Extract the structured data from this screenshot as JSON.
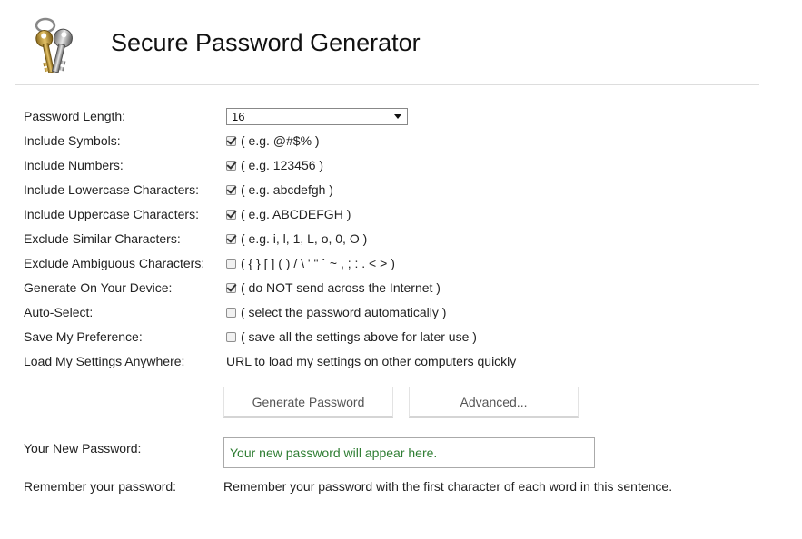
{
  "header": {
    "title": "Secure Password Generator"
  },
  "form": {
    "length": {
      "label": "Password Length:",
      "selected": "16"
    },
    "symbols": {
      "label": "Include Symbols:",
      "checked": true,
      "hint": "( e.g. @#$% )"
    },
    "numbers": {
      "label": "Include Numbers:",
      "checked": true,
      "hint": "( e.g. 123456 )"
    },
    "lowercase": {
      "label": "Include Lowercase Characters:",
      "checked": true,
      "hint": "( e.g. abcdefgh )"
    },
    "uppercase": {
      "label": "Include Uppercase Characters:",
      "checked": true,
      "hint": "( e.g. ABCDEFGH )"
    },
    "similar": {
      "label": "Exclude Similar Characters:",
      "checked": true,
      "hint": "( e.g. i, l, 1, L, o, 0, O )"
    },
    "ambiguous": {
      "label": "Exclude Ambiguous Characters:",
      "checked": false,
      "hint": "( { } [ ] ( ) / \\ ' \" ` ~ , ; : . < > )"
    },
    "device": {
      "label": "Generate On Your Device:",
      "checked": true,
      "hint": "( do NOT send across the Internet )"
    },
    "autoselect": {
      "label": "Auto-Select:",
      "checked": false,
      "hint": "( select the password automatically )"
    },
    "preference": {
      "label": "Save My Preference:",
      "checked": false,
      "hint": "( save all the settings above for later use )"
    },
    "load": {
      "label": "Load My Settings Anywhere:",
      "value": "URL to load my settings on other computers quickly"
    }
  },
  "buttons": {
    "generate": "Generate Password",
    "advanced": "Advanced..."
  },
  "result": {
    "label": "Your New Password:",
    "placeholder": "Your new password will appear here."
  },
  "remember": {
    "label": "Remember your password:",
    "text": "Remember your password with the first character of each word in this sentence."
  },
  "icons": {
    "logo": "keys-icon",
    "select_arrow": "chevron-down-icon"
  }
}
